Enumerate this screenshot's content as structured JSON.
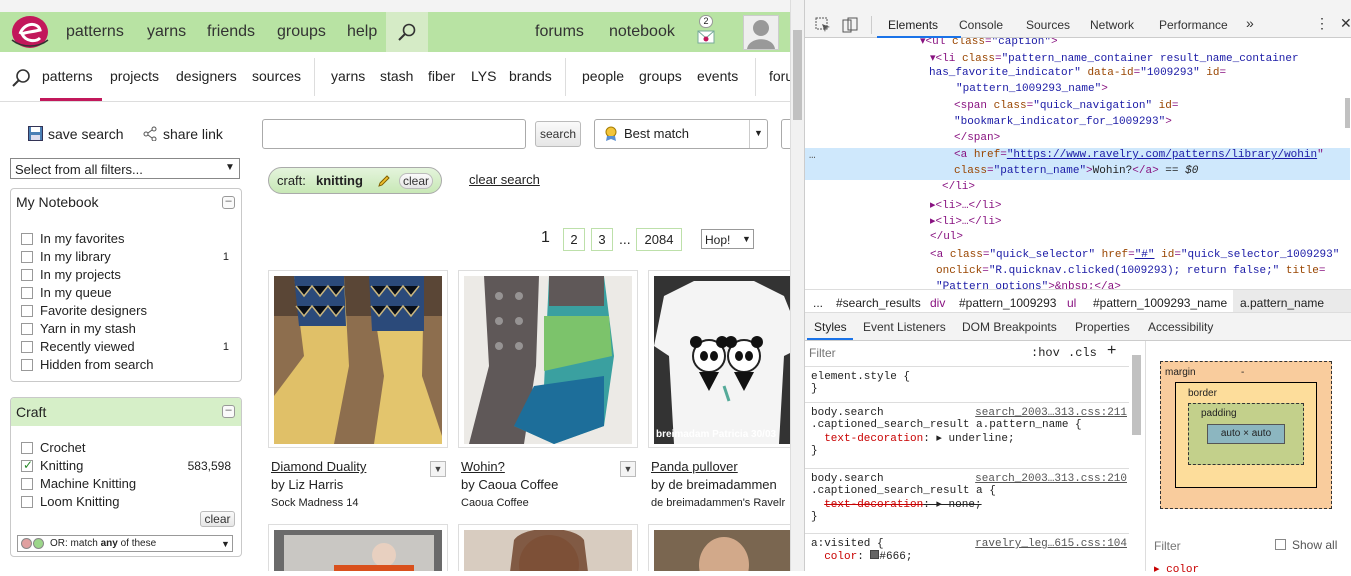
{
  "topnav": {
    "items": [
      "patterns",
      "yarns",
      "friends",
      "groups",
      "help"
    ],
    "right_items": [
      "forums",
      "notebook"
    ],
    "mail_badge": "2"
  },
  "subnav": {
    "items": [
      "patterns",
      "projects",
      "designers",
      "sources",
      "yarns",
      "stash",
      "fiber",
      "LYS",
      "brands",
      "people",
      "groups",
      "events",
      "foru"
    ]
  },
  "toolbar": {
    "save_search": "save search",
    "share_link": "share link",
    "search_btn": "search",
    "sort_value": "Best match",
    "filter_select": "Select from all filters..."
  },
  "filter_chip": {
    "prefix": "craft:",
    "value": "knitting",
    "clear": "clear"
  },
  "clear_search": "clear search",
  "pagination": {
    "current": "1",
    "pages": [
      "2",
      "3"
    ],
    "ellipsis": "...",
    "last": "2084",
    "hop": "Hop!"
  },
  "notebook": {
    "title": "My Notebook",
    "items": [
      {
        "label": "In my favorites",
        "count": ""
      },
      {
        "label": "In my library",
        "count": "1"
      },
      {
        "label": "In my projects",
        "count": ""
      },
      {
        "label": "In my queue",
        "count": ""
      },
      {
        "label": "Favorite designers",
        "count": ""
      },
      {
        "label": "Yarn in my stash",
        "count": ""
      },
      {
        "label": "Recently viewed",
        "count": "1"
      },
      {
        "label": "Hidden from search",
        "count": ""
      }
    ]
  },
  "craft": {
    "title": "Craft",
    "items": [
      {
        "label": "Crochet",
        "count": "",
        "checked": false
      },
      {
        "label": "Knitting",
        "count": "583,598",
        "checked": true
      },
      {
        "label": "Machine Knitting",
        "count": "",
        "checked": false
      },
      {
        "label": "Loom Knitting",
        "count": "",
        "checked": false
      }
    ],
    "clear": "clear",
    "match_prefix": "OR: match ",
    "match_any": "any",
    "match_suffix": " of these"
  },
  "results": [
    {
      "title": "Diamond Duality",
      "by": "by Liz Harris",
      "source": "Sock Madness 14"
    },
    {
      "title": "Wohin?",
      "by": "by Caoua Coffee",
      "source": "Caoua Coffee"
    },
    {
      "title": "Panda pullover",
      "by": "by de breimadammen",
      "source": "de breimadammen's Ravelr",
      "watermark": "breimadam Patricia 30/03"
    }
  ],
  "devtools": {
    "tabs": [
      "Elements",
      "Console",
      "Sources",
      "Network",
      "Performance"
    ],
    "more": "»",
    "breadcrumb": [
      "...",
      "#search_results",
      "div",
      "#pattern_1009293",
      "ul",
      "#pattern_1009293_name",
      "a.pattern_name"
    ],
    "subtabs": [
      "Styles",
      "Event Listeners",
      "DOM Breakpoints",
      "Properties",
      "Accessibility"
    ],
    "filter_placeholder": "Filter",
    "hov": ":hov",
    "cls": ".cls",
    "plus": "+",
    "computed_filter": "Filter",
    "show_all": "Show all",
    "box": {
      "margin": "margin",
      "border": "border",
      "padding": "padding",
      "content": "auto × auto",
      "dash": "-"
    }
  }
}
